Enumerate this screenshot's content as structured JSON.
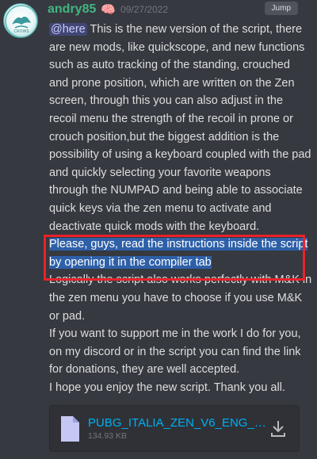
{
  "author": {
    "name": "andry85",
    "badge_icon": "brain-icon",
    "timestamp": "09/27/2022",
    "avatar_text": "CROWS"
  },
  "jump_label": "Jump",
  "message": {
    "mention": "@here",
    "body_1": " This is the new version of the script, there are new mods, like quickscope, and new functions such as auto tracking of the standing, crouched and prone position, which are written on the Zen screen, through this you can also adjust in the recoil menu the strength of the recoil in prone or crouch position,but the biggest addition is the possibility of using a keyboard coupled with the pad and quickly selecting your favorite weapons through the NUMPAD and being able to associate quick keys via the zen menu to activate and deactivate quick mods with the keyboard.",
    "highlighted": "Please, guys, read the instructions inside the script by opening it in the compiler tab",
    "body_2": "Logically the script also works perfectly with M&K in the zen menu you have to choose if you use M&K or pad.",
    "body_3": "If you want to support me in the work I do for you, on my discord or in the script you can find the link for donations, they are well accepted.",
    "body_4": "I hope you enjoy the new script. Thank you all."
  },
  "attachment": {
    "file_name": "PUBG_ITALIA_ZEN_V6_ENG_V...",
    "file_size": "134.93 KB",
    "icon": "file-icon",
    "action_icon": "download-icon"
  },
  "colors": {
    "background": "#36393f",
    "username": "#43b581",
    "link": "#00aff4",
    "selection": "#2e60a8",
    "annotation_box": "#e8222a"
  }
}
